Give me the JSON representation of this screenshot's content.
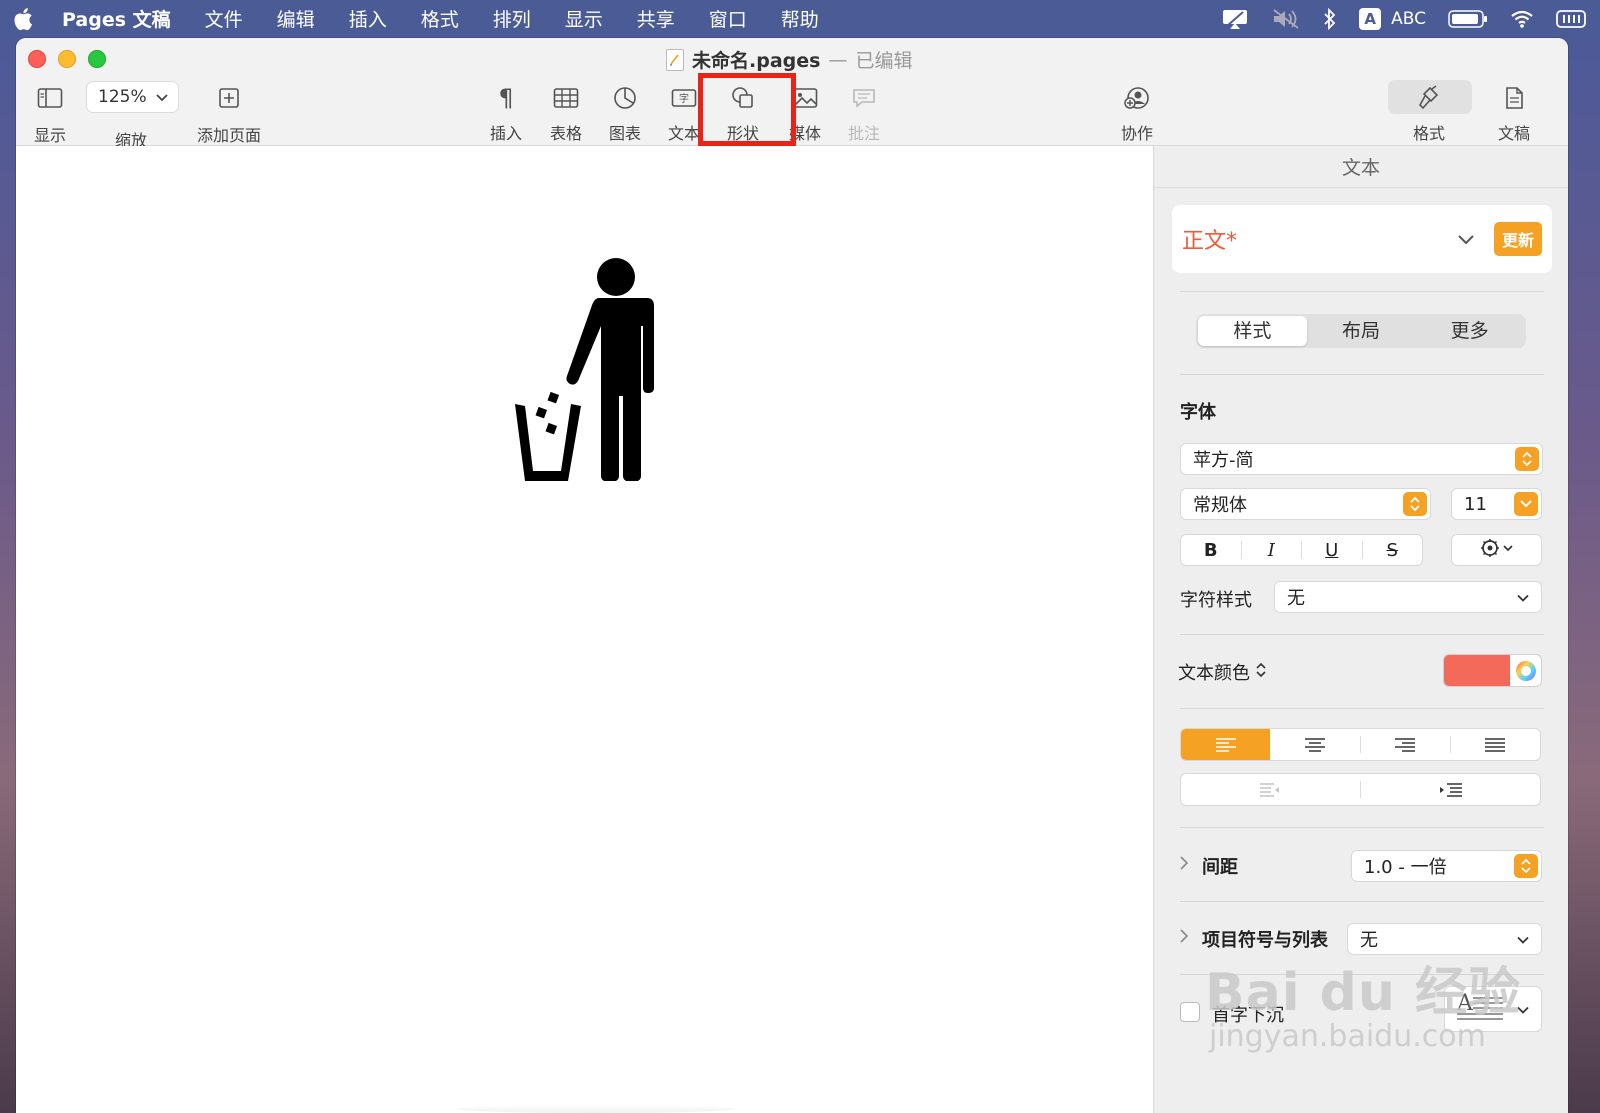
{
  "menubar": {
    "app": "Pages 文稿",
    "items": [
      "文件",
      "编辑",
      "插入",
      "格式",
      "排列",
      "显示",
      "共享",
      "窗口",
      "帮助"
    ],
    "ime_label": "ABC"
  },
  "window": {
    "title": "未命名.pages",
    "title_separator": "—",
    "edited_label": "已编辑"
  },
  "toolbar": {
    "view_label": "显示",
    "zoom_value": "125%",
    "zoom_label": "缩放",
    "add_page_label": "添加页面",
    "insert_label": "插入",
    "table_label": "表格",
    "chart_label": "图表",
    "text_label": "文本",
    "shape_label": "形状",
    "media_label": "媒体",
    "comment_label": "批注",
    "collaborate_label": "协作",
    "format_label": "格式",
    "document_label": "文稿"
  },
  "inspector": {
    "header": "文本",
    "paragraph_style": "正文*",
    "update_button": "更新",
    "tabs": [
      "样式",
      "布局",
      "更多"
    ],
    "font_section": "字体",
    "font_family": "苹方-简",
    "font_weight": "常规体",
    "font_size": "11",
    "bold": "B",
    "italic": "I",
    "underline": "U",
    "strike": "S",
    "char_style_label": "字符样式",
    "char_style_value": "无",
    "text_color_label": "文本颜色",
    "text_color": "#f36a5a",
    "spacing_label": "间距",
    "spacing_value": "1.0 - 一倍",
    "bullets_label": "项目符号与列表",
    "bullets_value": "无",
    "dropcap_label": "首字下沉"
  },
  "watermark": {
    "top": "Bai du 经验",
    "bottom": "jingyan.baidu.com"
  },
  "colors": {
    "accent": "#f4a124",
    "highlight": "#e8231a",
    "style_name": "#f05a35"
  }
}
